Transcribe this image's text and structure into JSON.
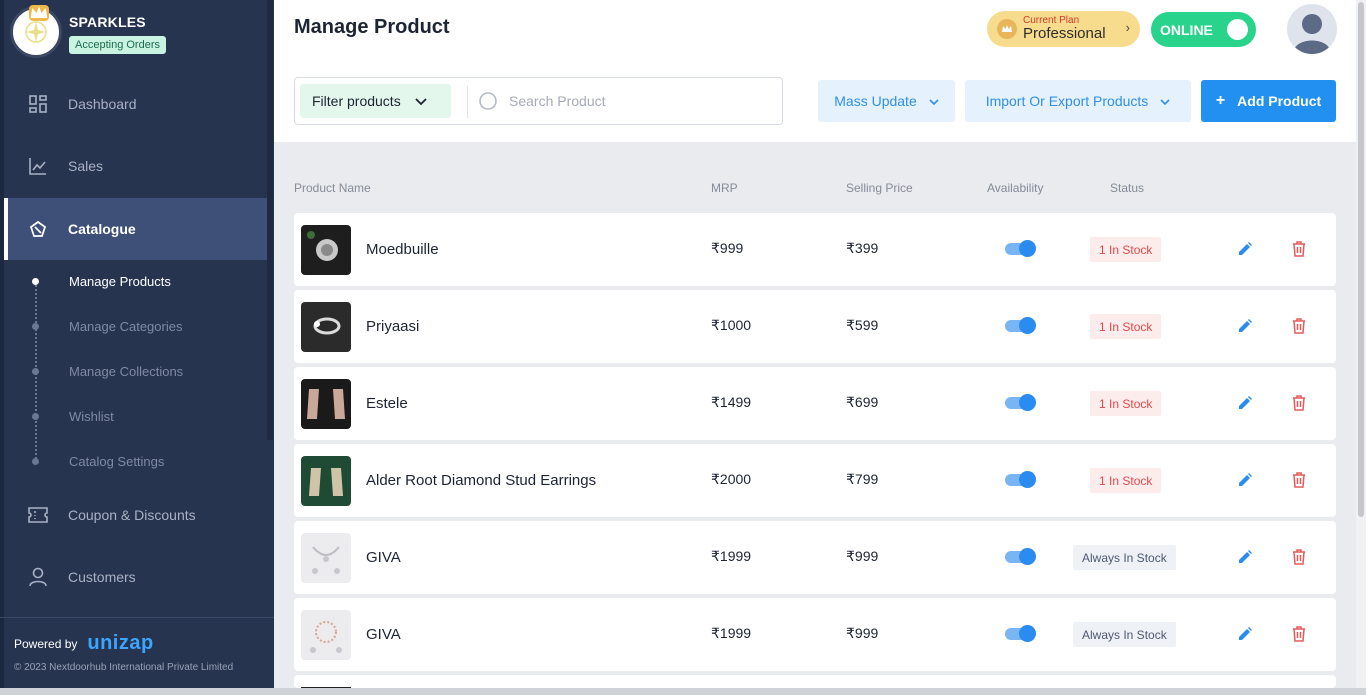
{
  "store": {
    "name": "SPARKLES",
    "badge": "Accepting Orders"
  },
  "nav": {
    "dashboard": "Dashboard",
    "sales": "Sales",
    "catalogue": "Catalogue",
    "coupons": "Coupon & Discounts",
    "customers": "Customers"
  },
  "sub_nav": {
    "manage_products": "Manage Products",
    "manage_categories": "Manage Categories",
    "manage_collections": "Manage Collections",
    "wishlist": "Wishlist",
    "catalog_settings": "Catalog Settings"
  },
  "footer": {
    "powered": "Powered by",
    "brand": "unizap",
    "copyright": "© 2023 Nextdoorhub International Private Limited"
  },
  "header": {
    "title": "Manage Product",
    "plan_label": "Current Plan",
    "plan_name": "Professional",
    "online": "ONLINE"
  },
  "toolbar": {
    "filter": "Filter products",
    "search_placeholder": "Search Product",
    "mass_update": "Mass Update",
    "import_export": "Import Or Export Products",
    "add_product": "Add Product"
  },
  "table": {
    "headers": {
      "name": "Product Name",
      "mrp": "MRP",
      "selling": "Selling Price",
      "availability": "Availability",
      "status": "Status"
    },
    "rows": [
      {
        "name": "Moedbuille",
        "mrp": "₹999",
        "selling": "₹399",
        "status": "1 In Stock",
        "status_type": "red",
        "available": true
      },
      {
        "name": "Priyaasi",
        "mrp": "₹1000",
        "selling": "₹599",
        "status": "1 In Stock",
        "status_type": "red",
        "available": true
      },
      {
        "name": "Estele",
        "mrp": "₹1499",
        "selling": "₹699",
        "status": "1 In Stock",
        "status_type": "red",
        "available": true
      },
      {
        "name": "Alder Root Diamond Stud Earrings",
        "mrp": "₹2000",
        "selling": "₹799",
        "status": "1 In Stock",
        "status_type": "red",
        "available": true
      },
      {
        "name": "GIVA",
        "mrp": "₹1999",
        "selling": "₹999",
        "status": "Always In Stock",
        "status_type": "gray",
        "available": true
      },
      {
        "name": "GIVA",
        "mrp": "₹1999",
        "selling": "₹999",
        "status": "Always In Stock",
        "status_type": "gray",
        "available": true
      }
    ]
  },
  "colors": {
    "sidebar": "#27344f",
    "accent": "#2290f0",
    "online": "#2ad38b",
    "danger": "#e04a4a"
  }
}
